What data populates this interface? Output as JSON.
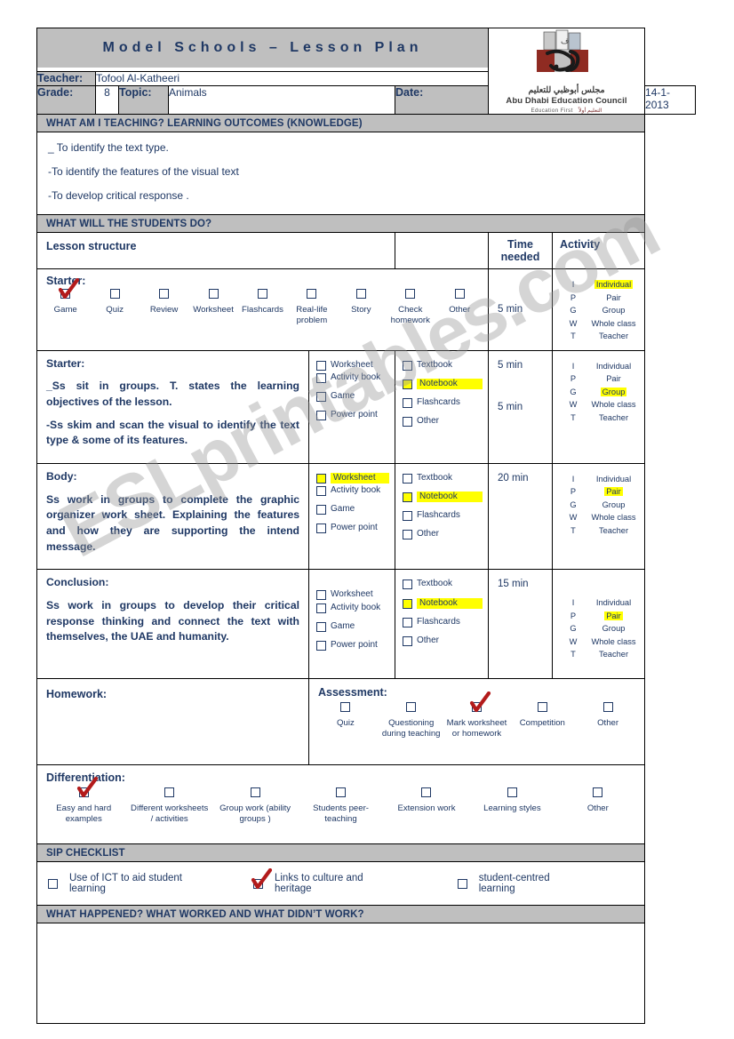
{
  "header": {
    "title": "Model Schools – Lesson Plan",
    "teacher_label": "Teacher:",
    "teacher_value": "Tofool  Al-Katheeri",
    "grade_label": "Grade:",
    "grade_value": "8",
    "topic_label": "Topic:",
    "topic_value": "Animals",
    "date_label": "Date:",
    "date_value": "14-1- 2013",
    "logo": {
      "arabic": "مجلس أبوظبي للتعليم",
      "english": "Abu Dhabi Education Council",
      "tagline_en": "Education First",
      "tagline_ar": "التعليم أولاً"
    }
  },
  "bands": {
    "outcomes": "WHAT AM I TEACHING?  LEARNING OUTCOMES (KNOWLEDGE)",
    "students_do": "WHAT WILL THE STUDENTS DO?",
    "sip": "SIP CHECKLIST",
    "reflection": "WHAT HAPPENED? WHAT WORKED AND WHAT DIDN’T WORK?"
  },
  "outcomes": [
    "_ To identify the text type.",
    "-To identify the features of the visual text",
    "-To develop critical response ."
  ],
  "columns": {
    "lesson_structure": "Lesson structure",
    "time_needed": "Time needed",
    "activity": "Activity"
  },
  "starter_options": {
    "stage_label": "Starter:",
    "items": [
      {
        "label": "Game",
        "checked": true
      },
      {
        "label": "Quiz",
        "checked": false
      },
      {
        "label": "Review",
        "checked": false
      },
      {
        "label": "Worksheet",
        "checked": false
      },
      {
        "label": "Flashcards",
        "checked": false
      },
      {
        "label": "Real-life problem",
        "checked": false
      },
      {
        "label": "Story",
        "checked": false
      },
      {
        "label": "Check homework",
        "checked": false
      },
      {
        "label": "Other",
        "checked": false
      }
    ],
    "time": "5 min",
    "activity_keys": [
      "I",
      "P",
      "G",
      "W",
      "T"
    ],
    "activity_values": [
      "Individual",
      "Pair",
      "Group",
      "Whole class",
      "Teacher"
    ],
    "activity_highlight": "Individual"
  },
  "rows": [
    {
      "stage": "Starter:",
      "paragraphs": [
        "_Ss sit in groups. T. states the learning objectives of the lesson.",
        "-Ss skim and scan the visual to identify the text type & some of its features."
      ],
      "resources_a": [
        {
          "label": "Worksheet",
          "highlight": false
        },
        {
          "label": "Activity book",
          "highlight": false
        },
        {
          "label": "Game",
          "highlight": false
        },
        {
          "label": "Power point",
          "highlight": false
        }
      ],
      "resources_b": [
        {
          "label": "Textbook",
          "highlight": false
        },
        {
          "label": "Notebook",
          "highlight": true
        },
        {
          "label": "Flashcards",
          "highlight": false
        },
        {
          "label": "Other",
          "highlight": false
        }
      ],
      "times": [
        "5 min",
        "5 min"
      ],
      "activity_keys": [
        "I",
        "P",
        "G",
        "W",
        "T"
      ],
      "activity_values": [
        "Individual",
        "Pair",
        "Group",
        "Whole class",
        "Teacher"
      ],
      "activity_highlight": "Group"
    },
    {
      "stage": "Body:",
      "paragraphs": [
        "Ss work in groups to complete the graphic organizer work sheet. Explaining the features and how they are supporting the intend message."
      ],
      "resources_a": [
        {
          "label": "Worksheet",
          "highlight": true
        },
        {
          "label": "Activity book",
          "highlight": false
        },
        {
          "label": "Game",
          "highlight": false
        },
        {
          "label": "Power point",
          "highlight": false
        }
      ],
      "resources_b": [
        {
          "label": "Textbook",
          "highlight": false
        },
        {
          "label": "Notebook",
          "highlight": true
        },
        {
          "label": "Flashcards",
          "highlight": false
        },
        {
          "label": "Other",
          "highlight": false
        }
      ],
      "times": [
        "20 min"
      ],
      "activity_keys": [
        "I",
        "P",
        "G",
        "W",
        "T"
      ],
      "activity_values": [
        "Individual",
        "Pair",
        "Group",
        "Whole class",
        "Teacher"
      ],
      "activity_highlight": "Pair"
    },
    {
      "stage": "Conclusion:",
      "paragraphs": [
        "Ss work in groups to develop their critical response thinking and connect the text with themselves, the UAE and humanity."
      ],
      "resources_a": [
        {
          "label": "Worksheet",
          "highlight": false
        },
        {
          "label": "Activity book",
          "highlight": false
        },
        {
          "label": "Game",
          "highlight": false
        },
        {
          "label": "Power point",
          "highlight": false
        }
      ],
      "resources_b": [
        {
          "label": "Textbook",
          "highlight": false
        },
        {
          "label": "Notebook",
          "highlight": true
        },
        {
          "label": "Flashcards",
          "highlight": false
        },
        {
          "label": "Other",
          "highlight": false
        }
      ],
      "times": [
        "15 min"
      ],
      "activity_keys": [
        "I",
        "P",
        "G",
        "W",
        "T"
      ],
      "activity_values": [
        "Individual",
        "Pair",
        "Group",
        "Whole class",
        "Teacher"
      ],
      "activity_highlight": "Pair"
    }
  ],
  "homework": {
    "label": "Homework:",
    "value": ""
  },
  "assessment": {
    "label": "Assessment:",
    "items": [
      {
        "label": "Quiz",
        "checked": false
      },
      {
        "label": "Questioning during teaching",
        "checked": false
      },
      {
        "label": "Mark worksheet or homework",
        "checked": true
      },
      {
        "label": "Competition",
        "checked": false
      },
      {
        "label": "Other",
        "checked": false
      }
    ]
  },
  "differentiation": {
    "label": "Differentiation:",
    "items": [
      {
        "label": "Easy and hard examples",
        "checked": true
      },
      {
        "label": "Different worksheets / activities",
        "checked": false
      },
      {
        "label": "Group work (ability groups )",
        "checked": false
      },
      {
        "label": "Students peer-teaching",
        "checked": false
      },
      {
        "label": "Extension work",
        "checked": false
      },
      {
        "label": "Learning styles",
        "checked": false
      },
      {
        "label": "Other",
        "checked": false
      }
    ]
  },
  "sip_checklist": [
    {
      "label": "Use of ICT to aid student learning",
      "checked": false
    },
    {
      "label": "Links to culture and heritage",
      "checked": true
    },
    {
      "label": "student-centred learning",
      "checked": false
    }
  ],
  "reflection_value": "",
  "watermark": "ESLprintables.com",
  "colors": {
    "band": "#BFBFBF",
    "text": "#1F3864",
    "highlight": "#FFFF00",
    "tick": "#B31B1B"
  }
}
